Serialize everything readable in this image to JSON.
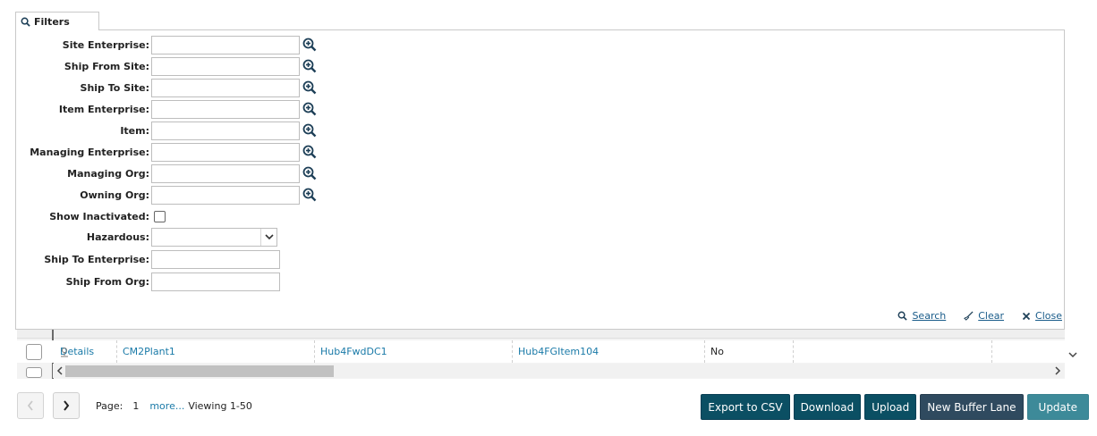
{
  "filters": {
    "tab_label": "Filters",
    "fields": [
      {
        "label": "Site Enterprise:",
        "value": ""
      },
      {
        "label": "Ship From Site:",
        "value": ""
      },
      {
        "label": "Ship To Site:",
        "value": ""
      },
      {
        "label": "Item Enterprise:",
        "value": ""
      },
      {
        "label": "Item:",
        "value": ""
      },
      {
        "label": "Managing Enterprise:",
        "value": ""
      },
      {
        "label": "Managing Org:",
        "value": ""
      },
      {
        "label": "Owning Org:",
        "value": ""
      }
    ],
    "show_inactivated_label": "Show Inactivated:",
    "show_inactivated_checked": false,
    "hazardous_label": "Hazardous:",
    "hazardous_value": "",
    "ship_to_enterprise_label": "Ship To Enterprise:",
    "ship_to_enterprise_value": "",
    "ship_from_org_label": "Ship From Org:",
    "ship_from_org_value": "",
    "actions": {
      "search": "Search",
      "clear": "Clear",
      "close": "Close"
    }
  },
  "grid": {
    "row": {
      "details": "Details",
      "col1": "CM2Plant1",
      "col2": "Hub4FwdDC1",
      "col3": "Hub4FGItem104",
      "col4": "No",
      "col5": ""
    }
  },
  "pager": {
    "page_label": "Page:",
    "page_number": "1",
    "more": "more...",
    "viewing": "Viewing 1-50"
  },
  "buttons": {
    "export_csv": "Export to CSV",
    "download": "Download",
    "upload": "Upload",
    "new_buffer_lane": "New Buffer Lane",
    "update": "Update"
  },
  "colors": {
    "primary_button": "#0b4f63",
    "secondary_button": "#2f4a5f",
    "update_button": "#3d8a99",
    "link": "#1a7aa8"
  }
}
